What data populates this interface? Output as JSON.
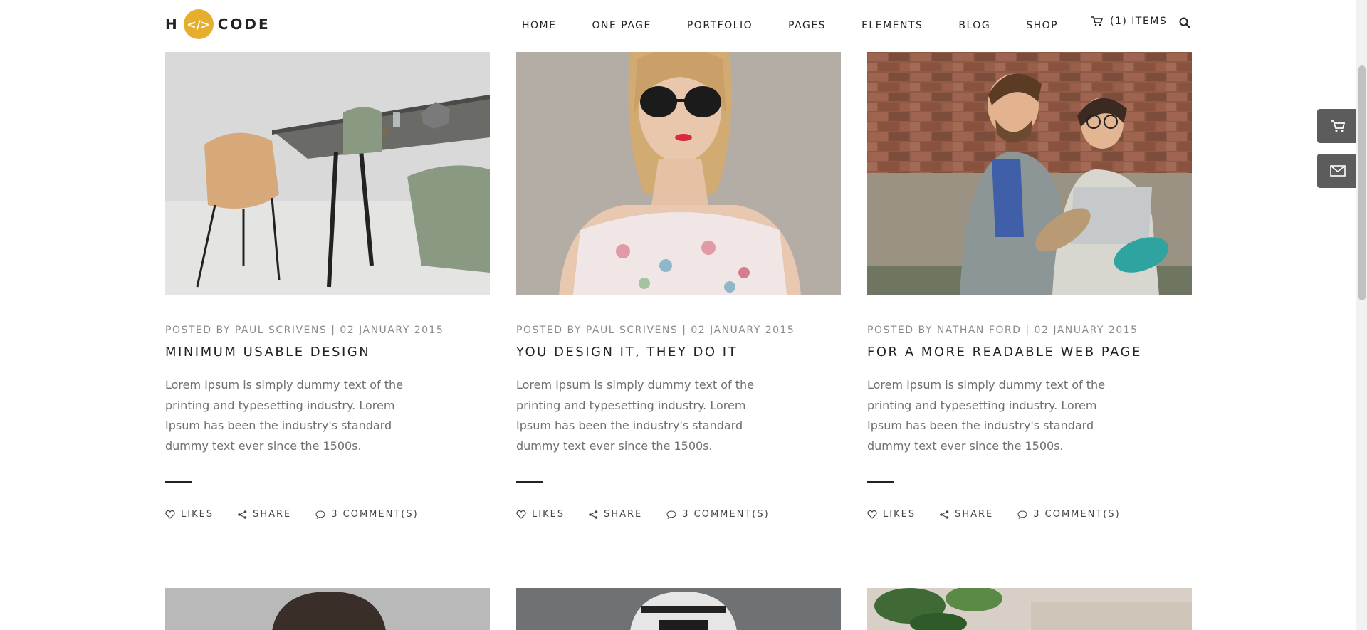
{
  "brand": {
    "left": "H",
    "badge": "</>",
    "right": "CODE"
  },
  "nav": [
    "HOME",
    "ONE PAGE",
    "PORTFOLIO",
    "PAGES",
    "ELEMENTS",
    "BLOG",
    "SHOP"
  ],
  "cart": {
    "label": "(1) ITEMS"
  },
  "posts": [
    {
      "meta": "POSTED BY PAUL SCRIVENS | 02 JANUARY 2015",
      "title": "MINIMUM USABLE DESIGN",
      "excerpt": "Lorem Ipsum is simply dummy text of the printing and typesetting industry. Lorem Ipsum has been the industry's standard dummy text ever since the 1500s.",
      "likes": "LIKES",
      "share": "SHARE",
      "comments": "3 COMMENT(S)"
    },
    {
      "meta": "POSTED BY PAUL SCRIVENS | 02 JANUARY 2015",
      "title": "YOU DESIGN IT, THEY DO IT",
      "excerpt": "Lorem Ipsum is simply dummy text of the printing and typesetting industry. Lorem Ipsum has been the industry's standard dummy text ever since the 1500s.",
      "likes": "LIKES",
      "share": "SHARE",
      "comments": "3 COMMENT(S)"
    },
    {
      "meta": "POSTED BY NATHAN FORD | 02 JANUARY 2015",
      "title": "FOR A MORE READABLE WEB PAGE",
      "excerpt": "Lorem Ipsum is simply dummy text of the printing and typesetting industry. Lorem Ipsum has been the industry's standard dummy text ever since the 1500s.",
      "likes": "LIKES",
      "share": "SHARE",
      "comments": "3 COMMENT(S)"
    }
  ],
  "colors": {
    "accent": "#e6ae2c",
    "heading": "#222222",
    "body": "#6f6f6f",
    "side_button": "#5c5c5c"
  },
  "icons": {
    "cart": "cart-icon",
    "search": "search-icon",
    "side_cart": "shopping-cart-icon",
    "side_mail": "envelope-icon",
    "likes": "heart-icon",
    "share": "share-icon",
    "comments": "comment-icon"
  }
}
